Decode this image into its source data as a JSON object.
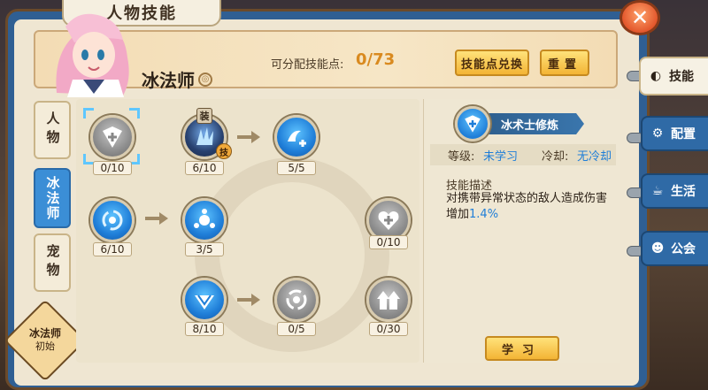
{
  "title": "人物技能",
  "header": {
    "class_name": "冰法师",
    "points_label": "可分配技能点:",
    "points_value": "0/73",
    "exchange_button": "技能点兑换",
    "reset_button": "重置"
  },
  "left_tabs": [
    {
      "label": "人物"
    },
    {
      "label": "冰法师"
    },
    {
      "label": "宠物"
    }
  ],
  "badge": {
    "line1": "冰法师",
    "line2": "初始"
  },
  "skills": [
    {
      "level": "0/10",
      "icon": "shield-plus-icon"
    },
    {
      "level": "6/10",
      "icon": "ice-crystal-icon",
      "tag_equip": "装",
      "tag_skill": "技"
    },
    {
      "level": "5/5",
      "icon": "wave-plus-icon"
    },
    {
      "level": "6/10",
      "icon": "vortex-icon"
    },
    {
      "level": "3/5",
      "icon": "nodes-icon"
    },
    {
      "level": "0/10",
      "icon": "heart-plus-icon"
    },
    {
      "level": "8/10",
      "icon": "diamond-icon"
    },
    {
      "level": "0/5",
      "icon": "swirl-icon"
    },
    {
      "level": "0/30",
      "icon": "arrows-up-icon"
    }
  ],
  "detail": {
    "name": "冰术士修炼",
    "level_label": "等级:",
    "level_value": "未学习",
    "cooldown_label": "冷却:",
    "cooldown_value": "无冷却",
    "desc_title": "技能描述",
    "desc_text": "对携带异常状态的敌人造成伤害增加",
    "desc_value": "1.4%",
    "learn_button": "学习"
  },
  "side_tabs": [
    {
      "label": "技能",
      "icon": "swirl-icon"
    },
    {
      "label": "配置",
      "icon": "gear-icon"
    },
    {
      "label": "生活",
      "icon": "cup-icon"
    },
    {
      "label": "公会",
      "icon": "people-icon"
    }
  ],
  "colors": {
    "accent_blue": "#1f7ed8",
    "points_orange": "#d98a1f",
    "button_yellow": "#f3b435",
    "frame_blue": "#2f5f93"
  }
}
